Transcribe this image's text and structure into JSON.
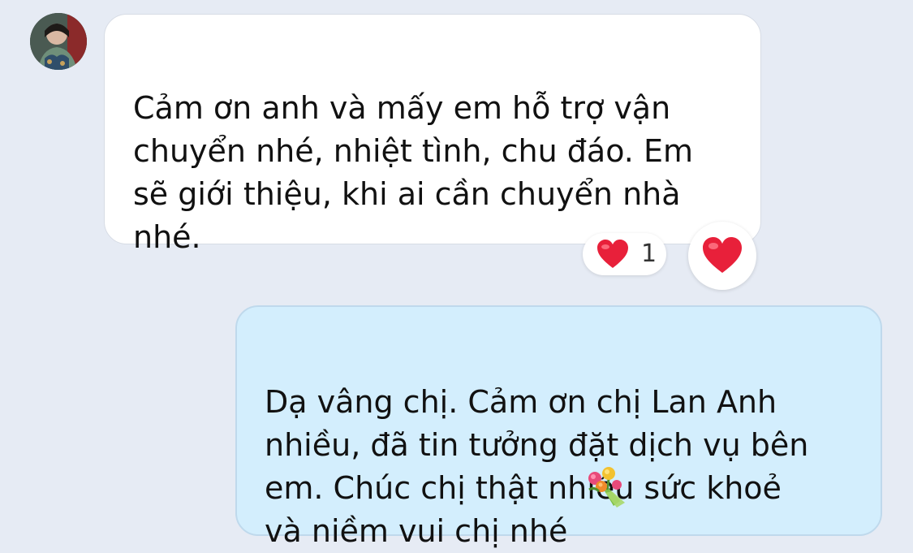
{
  "incoming_message": {
    "text": "Cảm ơn anh và mấy em hỗ trợ vận\nchuyển nhé, nhiệt tình, chu đáo. Em\nsẽ giới thiệu, khi ai cần chuyển nhà\nnhé."
  },
  "reaction": {
    "emoji": "heart-icon",
    "count": "1"
  },
  "outgoing_message": {
    "text": "Dạ vâng chị. Cảm ơn chị Lan Anh\nnhiều, đã tin tưởng đặt dịch vụ bên\nem. Chúc chị thật nhiều sức khoẻ\nvà niềm vui chị nhé",
    "emoji": "💐"
  },
  "colors": {
    "background": "#e6ebf4",
    "incoming_bubble": "#ffffff",
    "outgoing_bubble": "#d3eefd",
    "heart": "#e8203a"
  }
}
